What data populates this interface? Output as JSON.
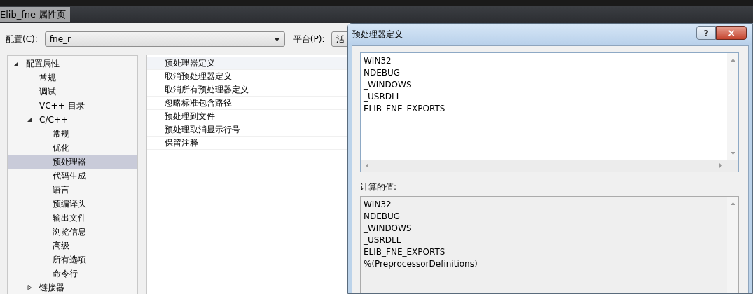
{
  "window": {
    "title": "Elib_fne 属性页"
  },
  "config": {
    "label": "配置(C):",
    "value": "fne_r"
  },
  "platform": {
    "label": "平台(P):",
    "value": "活"
  },
  "tree": [
    {
      "label": "配置属性",
      "expanded": true,
      "selected": false,
      "children": [
        {
          "label": "常规",
          "selected": false
        },
        {
          "label": "调试",
          "selected": false
        },
        {
          "label": "VC++ 目录",
          "selected": false
        },
        {
          "label": "C/C++",
          "expanded": true,
          "selected": false,
          "children": [
            {
              "label": "常规",
              "selected": false
            },
            {
              "label": "优化",
              "selected": false
            },
            {
              "label": "预处理器",
              "selected": true
            },
            {
              "label": "代码生成",
              "selected": false
            },
            {
              "label": "语言",
              "selected": false
            },
            {
              "label": "预编译头",
              "selected": false
            },
            {
              "label": "输出文件",
              "selected": false
            },
            {
              "label": "浏览信息",
              "selected": false
            },
            {
              "label": "高级",
              "selected": false
            },
            {
              "label": "所有选项",
              "selected": false
            },
            {
              "label": "命令行",
              "selected": false
            }
          ]
        },
        {
          "label": "链接器",
          "expanded": false,
          "selected": false
        }
      ]
    }
  ],
  "properties": [
    {
      "label": "预处理器定义",
      "selected": true
    },
    {
      "label": "取消预处理器定义",
      "selected": false
    },
    {
      "label": "取消所有预处理器定义",
      "selected": false
    },
    {
      "label": "忽略标准包含路径",
      "selected": false
    },
    {
      "label": "预处理到文件",
      "selected": false
    },
    {
      "label": "预处理取消显示行号",
      "selected": false
    },
    {
      "label": "保留注释",
      "selected": false
    }
  ],
  "dialog": {
    "title": "预处理器定义",
    "help_button": "?",
    "close_button": "×",
    "definitions": [
      "WIN32",
      "NDEBUG",
      "_WINDOWS",
      "_USRDLL",
      "ELIB_FNE_EXPORTS"
    ],
    "computed_label": "计算的值:",
    "computed": [
      "WIN32",
      "NDEBUG",
      "_WINDOWS",
      "_USRDLL",
      "ELIB_FNE_EXPORTS",
      "%(PreprocessorDefinitions)"
    ]
  }
}
